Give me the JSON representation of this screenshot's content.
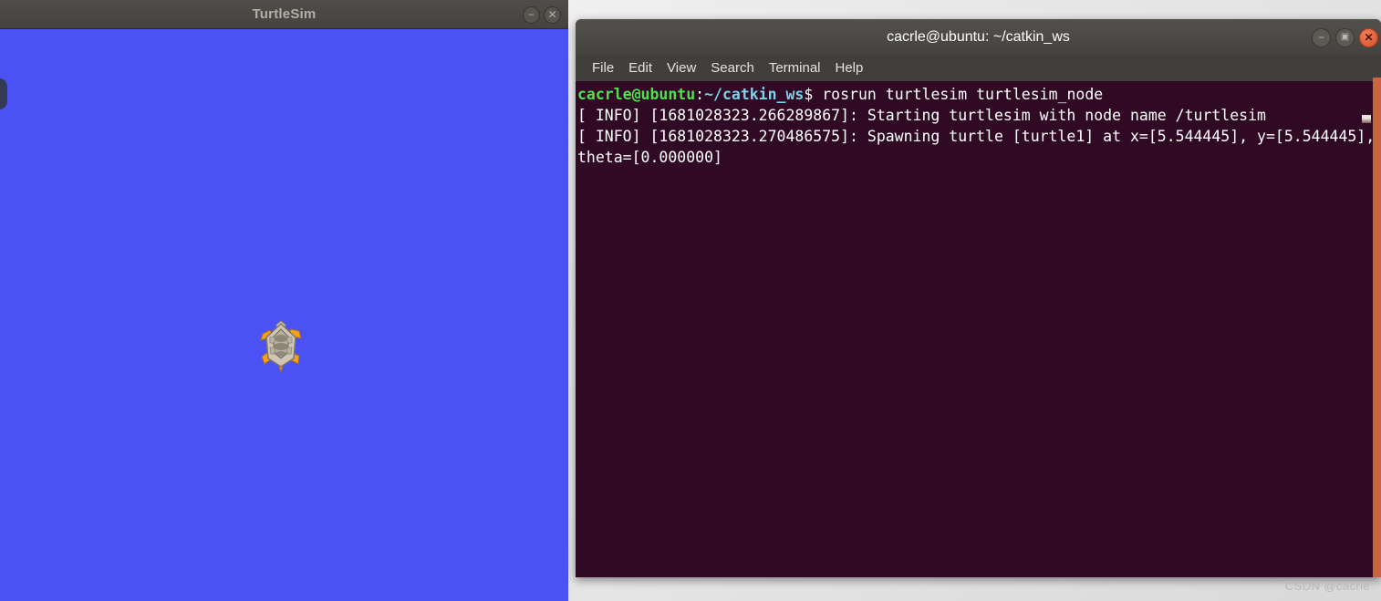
{
  "turtlesim": {
    "title": "TurtleSim",
    "background_color": "#4a52f5",
    "titlebar_color": "#4a4845",
    "buttons": {
      "minimize": "−",
      "close": "✕"
    },
    "turtle": {
      "name": "turtle1",
      "shell_color": "#cfc6b4",
      "limb_color": "#f0a020",
      "x": "5.544445",
      "y": "5.544445",
      "theta": "0.000000"
    }
  },
  "terminal": {
    "title": "cacrle@ubuntu: ~/catkin_ws",
    "background_color": "#300a24",
    "titlebar_color": "#4a4845",
    "accent_close_color": "#d4502a",
    "buttons": {
      "minimize": "−",
      "maximize": "▣",
      "close": "✕"
    },
    "menu": [
      {
        "label": "File"
      },
      {
        "label": "Edit"
      },
      {
        "label": "View"
      },
      {
        "label": "Search"
      },
      {
        "label": "Terminal"
      },
      {
        "label": "Help"
      }
    ],
    "prompt": {
      "user_host": "cacrle@ubuntu",
      "colon": ":",
      "path": "~/catkin_ws",
      "symbol": "$ "
    },
    "command": "rosrun turtlesim turtlesim_node",
    "output_lines": [
      "[ INFO] [1681028323.266289867]: Starting turtlesim with node name /turtlesim",
      "[ INFO] [1681028323.270486575]: Spawning turtle [turtle1] at x=[5.544445], y=[5.544445], theta=[0.000000]"
    ]
  },
  "watermark": "CSDN @cacrle"
}
